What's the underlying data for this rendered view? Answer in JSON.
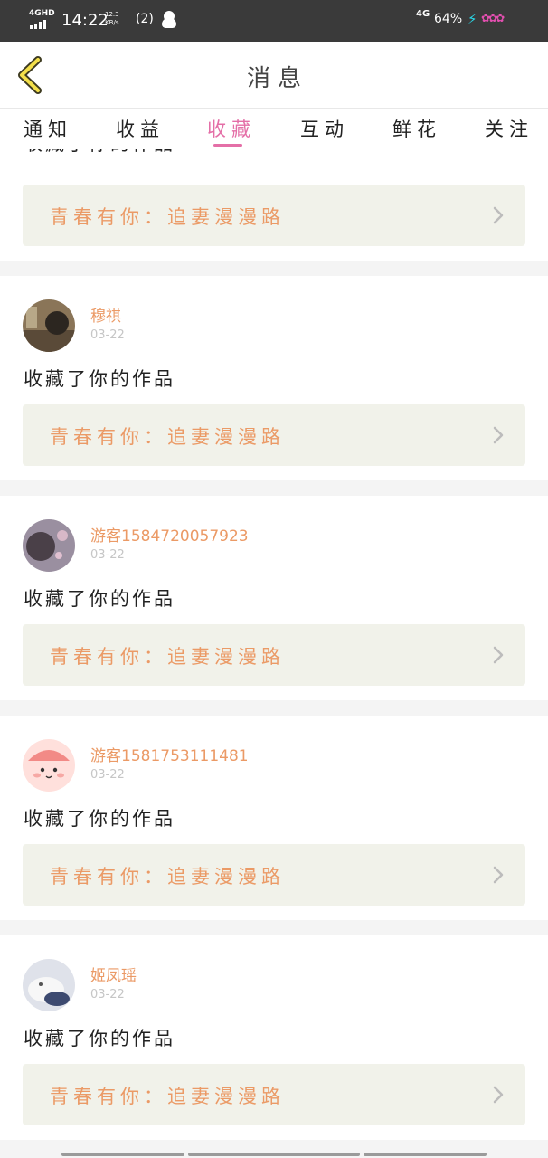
{
  "status_bar": {
    "network": "4GHD",
    "time": "14:22",
    "speed_value": "12.3",
    "speed_unit": "KB/s",
    "nfc": "(2)",
    "network_right": "4G",
    "battery": "64%"
  },
  "header": {
    "title": "消息"
  },
  "tabs": [
    {
      "label": "通知",
      "active": false
    },
    {
      "label": "收益",
      "active": false
    },
    {
      "label": "收藏",
      "active": true
    },
    {
      "label": "互动",
      "active": false
    },
    {
      "label": "鲜花",
      "active": false
    },
    {
      "label": "关注",
      "active": false
    }
  ],
  "items": [
    {
      "action": "收藏了你的作品",
      "work_title": "青春有你：追妻漫漫路"
    },
    {
      "username": "穆祺",
      "date": "03-22",
      "action": "收藏了你的作品",
      "work_title": "青春有你：追妻漫漫路"
    },
    {
      "username": "游客1584720057923",
      "date": "03-22",
      "action": "收藏了你的作品",
      "work_title": "青春有你：追妻漫漫路"
    },
    {
      "username": "游客1581753111481",
      "date": "03-22",
      "action": "收藏了你的作品",
      "work_title": "青春有你：追妻漫漫路"
    },
    {
      "username": "姬凤瑶",
      "date": "03-22",
      "action": "收藏了你的作品",
      "work_title": "青春有你：追妻漫漫路"
    }
  ],
  "colors": {
    "accent_pink": "#e46fa7",
    "username_orange": "#eb9a66",
    "work_card_bg": "#f1f2ea",
    "status_bar_bg": "#3a3a3a"
  },
  "icons": [
    "back-chevron-icon",
    "chevron-right-icon",
    "qq-icon",
    "nfc-icon",
    "signal-icon",
    "lightning-icon"
  ]
}
